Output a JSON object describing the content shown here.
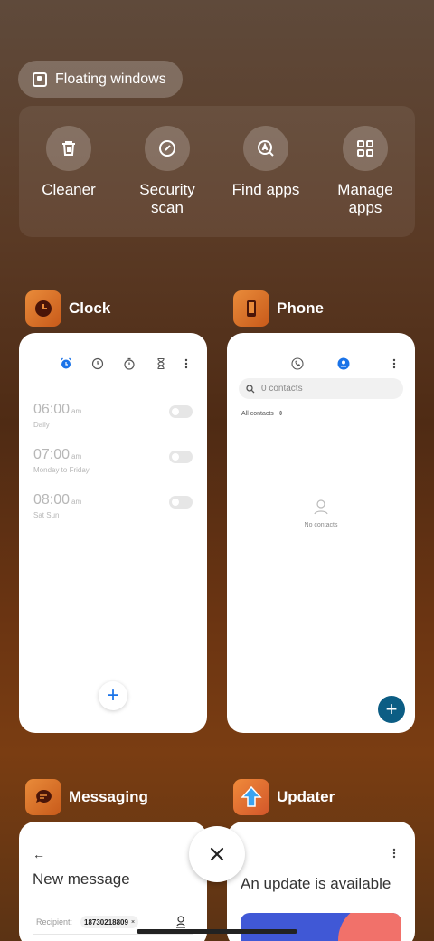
{
  "floating_windows": {
    "label": "Floating windows"
  },
  "tools": [
    {
      "label": "Cleaner",
      "icon": "trash-icon"
    },
    {
      "label": "Security scan",
      "icon": "shield-check-icon"
    },
    {
      "label": "Find apps",
      "icon": "search-a-icon"
    },
    {
      "label": "Manage apps",
      "icon": "grid-icon"
    }
  ],
  "clock": {
    "name": "Clock",
    "accent": "#1a73e8",
    "alarms": [
      {
        "time": "06:00",
        "ampm": "am",
        "repeat": "Daily"
      },
      {
        "time": "07:00",
        "ampm": "am",
        "repeat": "Monday to Friday"
      },
      {
        "time": "08:00",
        "ampm": "am",
        "repeat": "Sat Sun"
      }
    ]
  },
  "phone": {
    "name": "Phone",
    "search_placeholder": "0 contacts",
    "filter": "All contacts",
    "empty_text": "No contacts",
    "fab_color": "#0c5d84"
  },
  "messaging": {
    "name": "Messaging",
    "title": "New message",
    "recipient_label": "Recipient:",
    "recipient_chip": "18730218809"
  },
  "updater": {
    "name": "Updater",
    "headline": "An update is available"
  }
}
